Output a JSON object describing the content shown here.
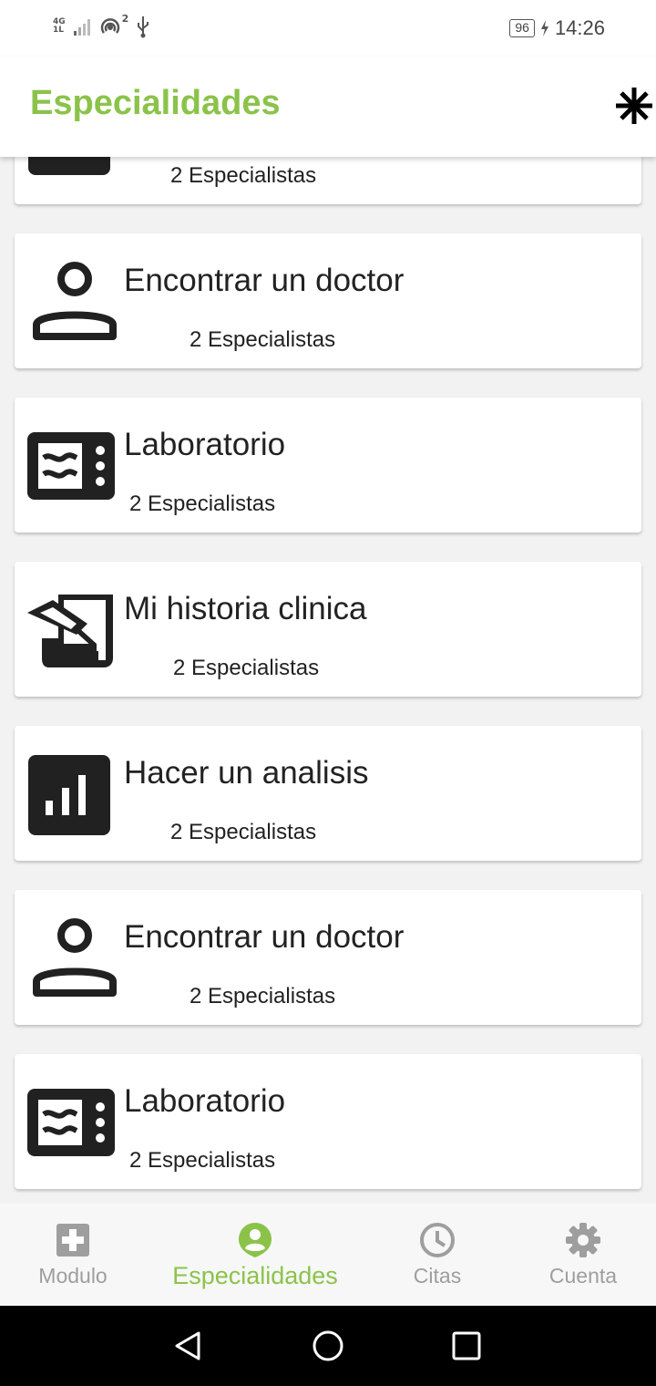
{
  "status_bar": {
    "network": "4G",
    "network_sub": "1L",
    "hotspot_count": "2",
    "battery": "96",
    "time": "14:26"
  },
  "app_bar": {
    "title": "Especialidades",
    "debug_icon": "debug-asterisk-icon"
  },
  "cards": [
    {
      "title": "",
      "subtitle": "2 Especialistas",
      "icon": "calendar-icon"
    },
    {
      "title": "Encontrar un doctor",
      "subtitle": "2 Especialistas",
      "icon": "person-icon"
    },
    {
      "title": "Laboratorio",
      "subtitle": "2 Especialistas",
      "icon": "microwave-icon"
    },
    {
      "title": "Mi historia clinica",
      "subtitle": "2 Especialistas",
      "icon": "history-edu-icon"
    },
    {
      "title": "Hacer un analisis",
      "subtitle": "2 Especialistas",
      "icon": "analytics-icon"
    },
    {
      "title": "Encontrar un doctor",
      "subtitle": "2 Especialistas",
      "icon": "person-icon"
    },
    {
      "title": "Laboratorio",
      "subtitle": "2 Especialistas",
      "icon": "microwave-icon"
    }
  ],
  "bottom_nav": {
    "items": [
      {
        "label": "Modulo",
        "icon": "medical-plus-icon",
        "active": false
      },
      {
        "label": "Especialidades",
        "icon": "doctor-pin-icon",
        "active": true
      },
      {
        "label": "Citas",
        "icon": "clock-icon",
        "active": false
      },
      {
        "label": "Cuenta",
        "icon": "gear-icon",
        "active": false
      }
    ]
  },
  "colors": {
    "accent": "#8bc34a",
    "inactive": "#9e9e9e",
    "icon_dark": "#212121"
  }
}
